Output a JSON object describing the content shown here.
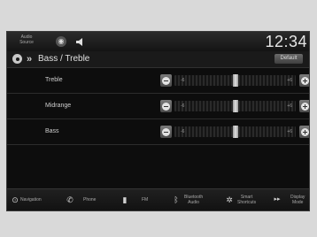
{
  "status_bar": {
    "audio_source_label": "Audio\nSource",
    "clock": "12:34"
  },
  "title_bar": {
    "title": "Bass / Treble",
    "default_button": "Default"
  },
  "rows": [
    {
      "label": "Treble",
      "min_label": "-6",
      "max_label": "+6",
      "value": 0,
      "min": -6,
      "max": 6
    },
    {
      "label": "Midrange",
      "min_label": "-6",
      "max_label": "+6",
      "value": 0,
      "min": -6,
      "max": 6
    },
    {
      "label": "Bass",
      "min_label": "-6",
      "max_label": "+6",
      "value": 0,
      "min": -6,
      "max": 6
    }
  ],
  "bottom_bar": {
    "navigation": "Navigation",
    "phone": "Phone",
    "fm": "FM",
    "bluetooth_audio": "Bluetooth\nAudio",
    "smart_shortcuts": "Smart\nShortcuts",
    "display_mode": "Display\nMode"
  },
  "icons": {
    "navigation": "compass-icon",
    "phone": "phone-icon",
    "fm": "radio-icon",
    "bluetooth": "bluetooth-icon",
    "smart": "star-icon",
    "display": "display-icon"
  }
}
